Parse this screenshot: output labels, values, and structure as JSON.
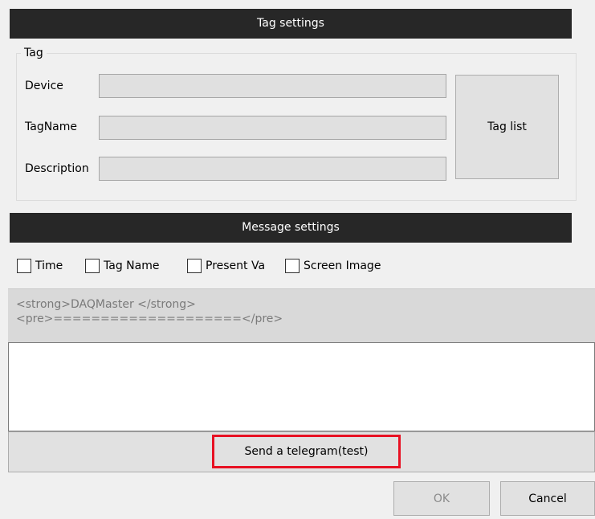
{
  "tag_section": {
    "header": "Tag settings",
    "group_label": "Tag",
    "device_label": "Device",
    "device_value": "",
    "tagname_label": "TagName",
    "tagname_value": "",
    "description_label": "Description",
    "description_value": "",
    "tag_list_button": "Tag list"
  },
  "message_section": {
    "header": "Message settings",
    "checkboxes": [
      {
        "label": "Time",
        "checked": false
      },
      {
        "label": "Tag Name",
        "checked": false
      },
      {
        "label": "Present Va",
        "checked": false
      },
      {
        "label": "Screen Image",
        "checked": false
      }
    ],
    "template_text": "<strong>DAQMaster </strong>\n<pre>====================</pre>",
    "message_value": "",
    "send_button": "Send a telegram(test)"
  },
  "dialog_buttons": {
    "ok": "OK",
    "cancel": "Cancel"
  }
}
